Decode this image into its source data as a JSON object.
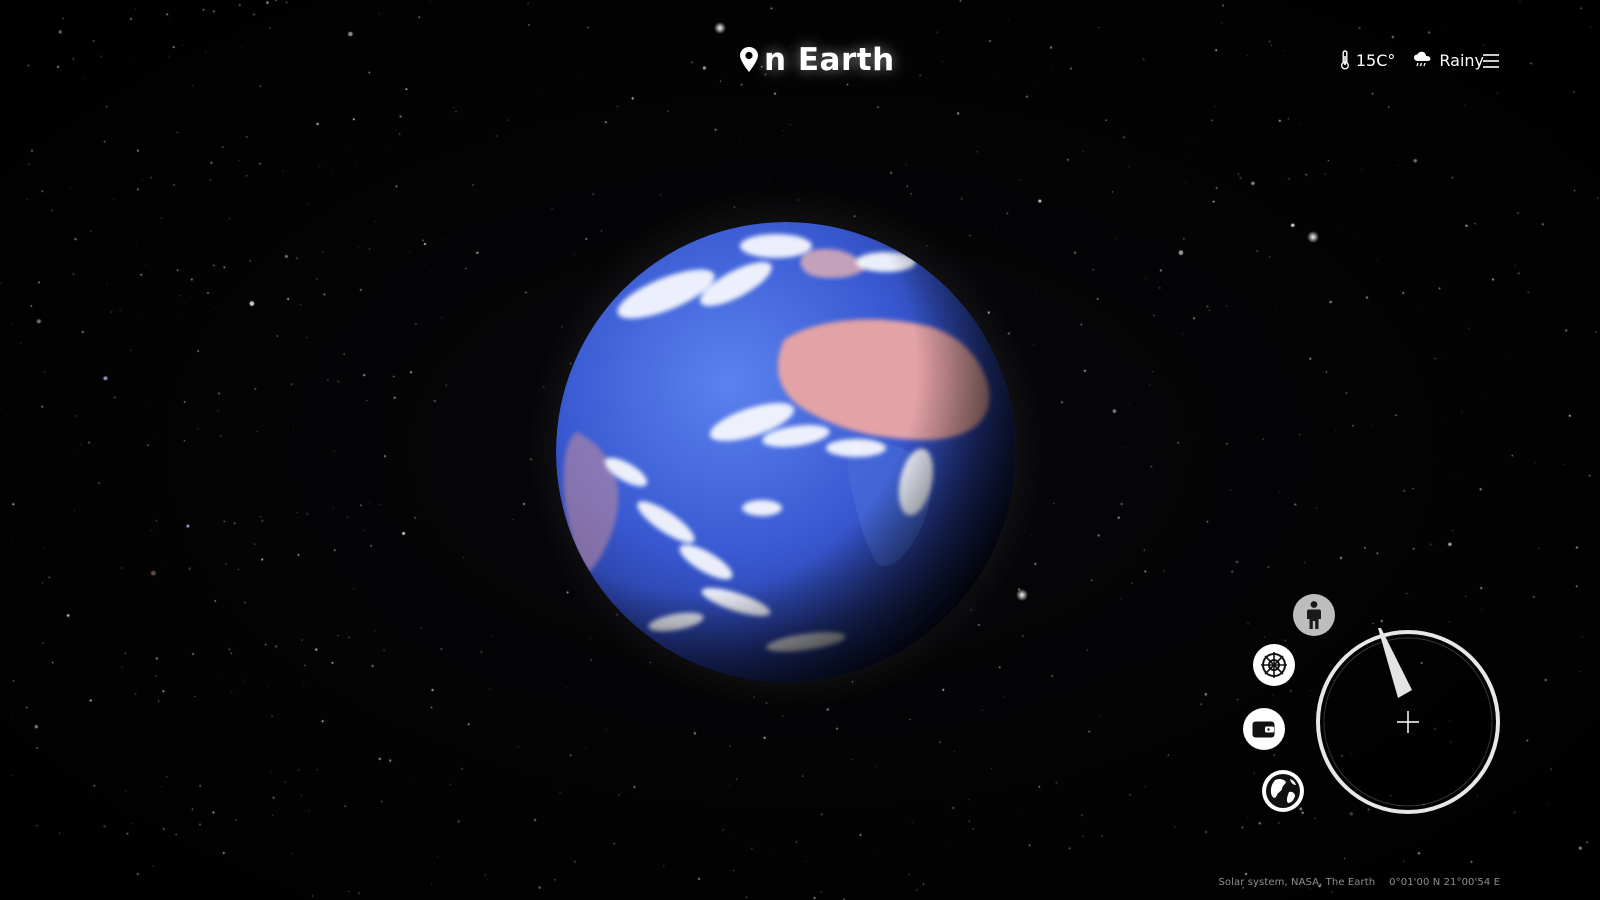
{
  "app": {
    "brand_prefix": "on",
    "brand_name": "Earth"
  },
  "weather": {
    "temperature": "15C°",
    "condition": "Rainy",
    "temperature_icon": "thermometer-icon",
    "condition_icon": "rain-cloud-icon"
  },
  "header": {
    "menu_icon": "hamburger-menu-icon"
  },
  "controls": {
    "person_icon": "person-icon",
    "satellite_icon": "target-icon",
    "wallet_icon": "wallet-icon",
    "globe_icon": "globe-icon",
    "compass_icon": "compass-needle-icon"
  },
  "footer": {
    "credits": "Solar system, NASA, The Earth",
    "coordinates": "0°01'00 N  21°00'54 E"
  },
  "colors": {
    "background": "#000000",
    "ocean": "#3b62d9",
    "continent": "#e2a0a4",
    "control_light": "#ffffff",
    "control_grey": "#bdbdbd"
  }
}
